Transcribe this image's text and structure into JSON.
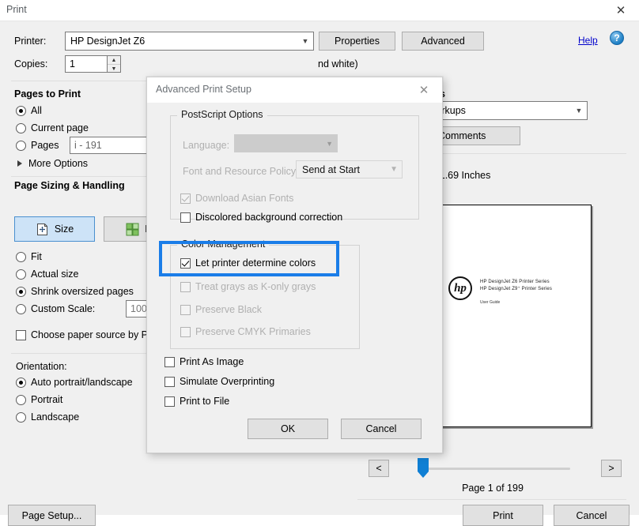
{
  "window": {
    "title": "Print",
    "close_icon": "✕"
  },
  "printer": {
    "label": "Printer:",
    "value": "HP DesignJet Z6",
    "properties_label": "Properties",
    "advanced_label": "Advanced",
    "help_label": "Help",
    "help_icon": "?"
  },
  "copies": {
    "label": "Copies:",
    "value": "1",
    "spin_up": "▲",
    "spin_down": "▼",
    "grayscale_note": "nd white)"
  },
  "pages_to_print": {
    "title": "Pages to Print",
    "option_all": "All",
    "option_current": "Current page",
    "option_pages": "Pages",
    "pages_value": "i - 191",
    "more_options": "More Options"
  },
  "page_sizing": {
    "title": "Page Sizing & Handling",
    "tab_size": "Size",
    "tab_poster": "Pos",
    "option_fit": "Fit",
    "option_actual": "Actual size",
    "option_shrink": "Shrink oversized pages",
    "option_custom": "Custom Scale:",
    "custom_scale_value": "100",
    "choose_paper_source": "Choose paper source by PDF"
  },
  "orientation": {
    "label": "Orientation:",
    "option_auto": "Auto portrait/landscape",
    "option_portrait": "Portrait",
    "option_landscape": "Landscape"
  },
  "comments_forms": {
    "title": "rms",
    "selected": "Markups",
    "summarize_label": "e Comments"
  },
  "preview": {
    "page_dimensions": "x 11.69 Inches",
    "doc_line1": "HP DesignJet Z6 Printer Series",
    "doc_line2": "HP DesignJet Z9⁺ Printer Series",
    "doc_subtitle": "User Guide",
    "logo_text": "hp",
    "prev_label": "<",
    "next_label": ">",
    "page_indicator": "Page 1 of 199"
  },
  "footer": {
    "page_setup_label": "Page Setup...",
    "print_label": "Print",
    "cancel_label": "Cancel"
  },
  "advanced_dialog": {
    "title": "Advanced Print Setup",
    "close_icon": "✕",
    "postscript": {
      "group_title": "PostScript Options",
      "language_label": "Language:",
      "language_value": "",
      "font_policy_label": "Font and Resource Policy:",
      "font_policy_value": "Send at Start",
      "download_asian_fonts": "Download Asian Fonts",
      "discolored_background": "Discolored background correction"
    },
    "color_management": {
      "group_title": "Color Management",
      "let_printer_determine": "Let printer determine colors",
      "treat_grays": "Treat grays as K-only grays",
      "preserve_black": "Preserve Black",
      "preserve_cmyk": "Preserve CMYK Primaries",
      "highlight_color": "#1a7de8"
    },
    "print_as_image": "Print As Image",
    "simulate_overprinting": "Simulate Overprinting",
    "print_to_file": "Print to File",
    "ok_label": "OK",
    "cancel_label": "Cancel"
  }
}
